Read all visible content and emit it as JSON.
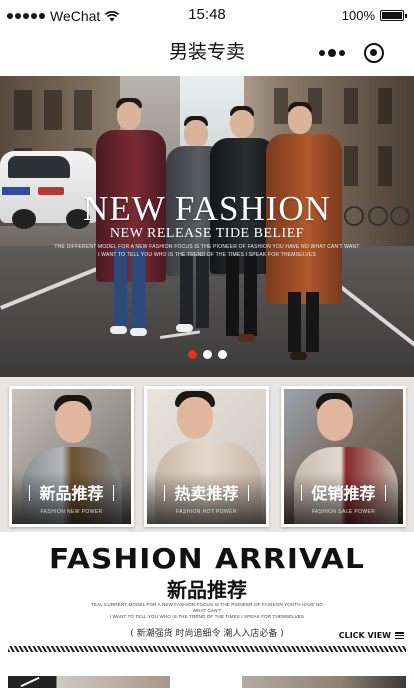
{
  "status_bar": {
    "carrier": "WeChat",
    "time": "15:48",
    "battery": "100%"
  },
  "nav": {
    "title": "男装专卖"
  },
  "banner": {
    "headline": "NEW FASHION",
    "subline": "NEW RELEASE TIDE BELIEF",
    "tiny_line_1": "THE DIFFERENT MODEL FOR A NEW FASHION FOCUS IS THE PIONEER OF FASHION YOU HAVE NO WHAT CAN'T WANT",
    "tiny_line_2": "I WANT TO TELL YOU WHO IS THE TREND OF THE TIMES I SPEAK FOR THEMSELVES",
    "slides": 3,
    "active_slide": 1
  },
  "categories": [
    {
      "label": "新品推荐",
      "sub": "FASHION NEW POWER"
    },
    {
      "label": "热卖推荐",
      "sub": "FASHION HOT POWER"
    },
    {
      "label": "促销推荐",
      "sub": "FASHION SALE POWER"
    }
  ],
  "arrival": {
    "title_en": "FASHION ARRIVAL",
    "title_cn": "新品推荐",
    "desc_1": "TEAL CURRENT MODEL FOR A NEW FASHION FOCUS IS THE PIONEER OF FASHION YOUTH HAVE NO WHAT CAN'T",
    "desc_2": "I WANT TO TELL YOU WHO IS THE TREND OF THE TIMES I SPEAK FOR THEMSELVES",
    "tagline": "( 新潮强货  时尚追细令  潮人入店必备 )",
    "click_view": "CLICK VIEW"
  },
  "colors": {
    "accent": "#e3341d",
    "text": "#111111",
    "card_bg": "#e7e6e4"
  }
}
